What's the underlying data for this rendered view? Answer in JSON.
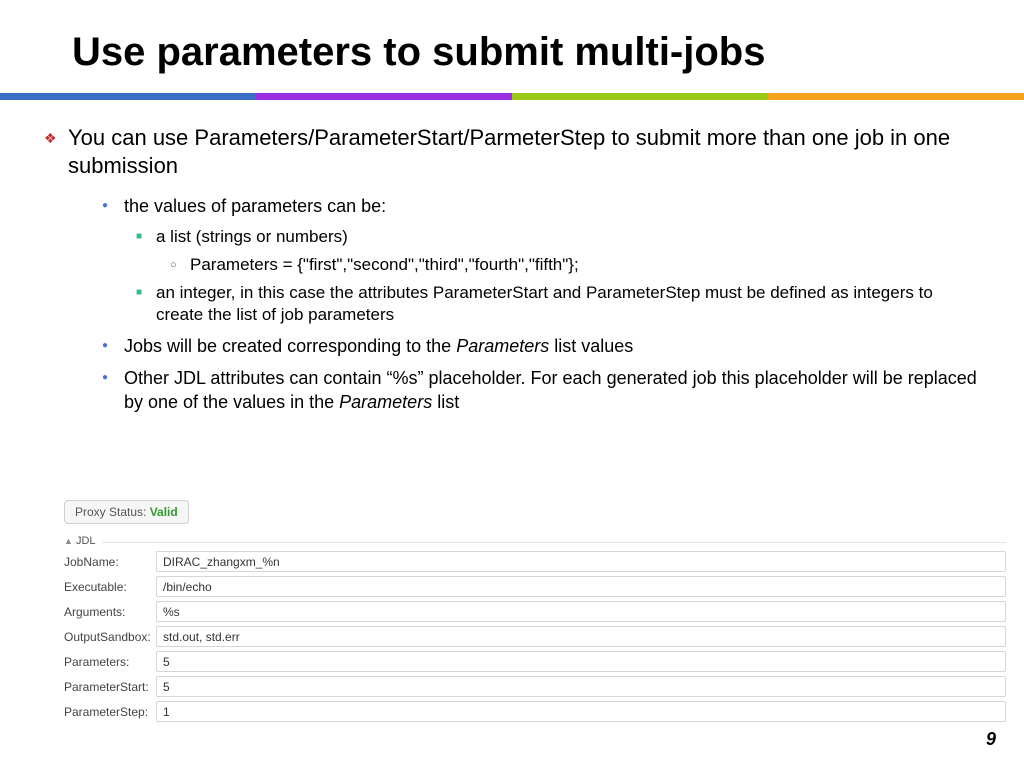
{
  "title": "Use parameters to submit multi-jobs",
  "main_bullet": "You can use Parameters/ParameterStart/ParmeterStep to submit more than one job in one submission",
  "sub": {
    "values_line": "the values of parameters can be:",
    "list_opt": "a list (strings or numbers)",
    "param_example": "Parameters = {\"first\",\"second\",\"third\",\"fourth\",\"fifth\"};",
    "int_opt": "an integer, in this case the attributes ParameterStart and ParameterStep must be defined as integers to create the list of job parameters",
    "jobs_line_pre": "Jobs will be created corresponding to the ",
    "jobs_line_em": "Parameters",
    "jobs_line_post": " list values",
    "other_pre": " Other JDL attributes can contain “%s” placeholder. For each generated job this placeholder will be replaced by one of the values in the ",
    "other_em": "Parameters",
    "other_post": " list"
  },
  "proxy": {
    "label": "Proxy Status: ",
    "value": "Valid"
  },
  "jdl_label": "JDL",
  "form": {
    "rows": [
      {
        "label": "JobName:",
        "value": "DIRAC_zhangxm_%n"
      },
      {
        "label": "Executable:",
        "value": "/bin/echo"
      },
      {
        "label": "Arguments:",
        "value": "%s"
      },
      {
        "label": "OutputSandbox:",
        "value": "std.out, std.err"
      },
      {
        "label": "Parameters:",
        "value": "5"
      },
      {
        "label": "ParameterStart:",
        "value": "5"
      },
      {
        "label": "ParameterStep:",
        "value": "1"
      }
    ]
  },
  "page_number": "9"
}
